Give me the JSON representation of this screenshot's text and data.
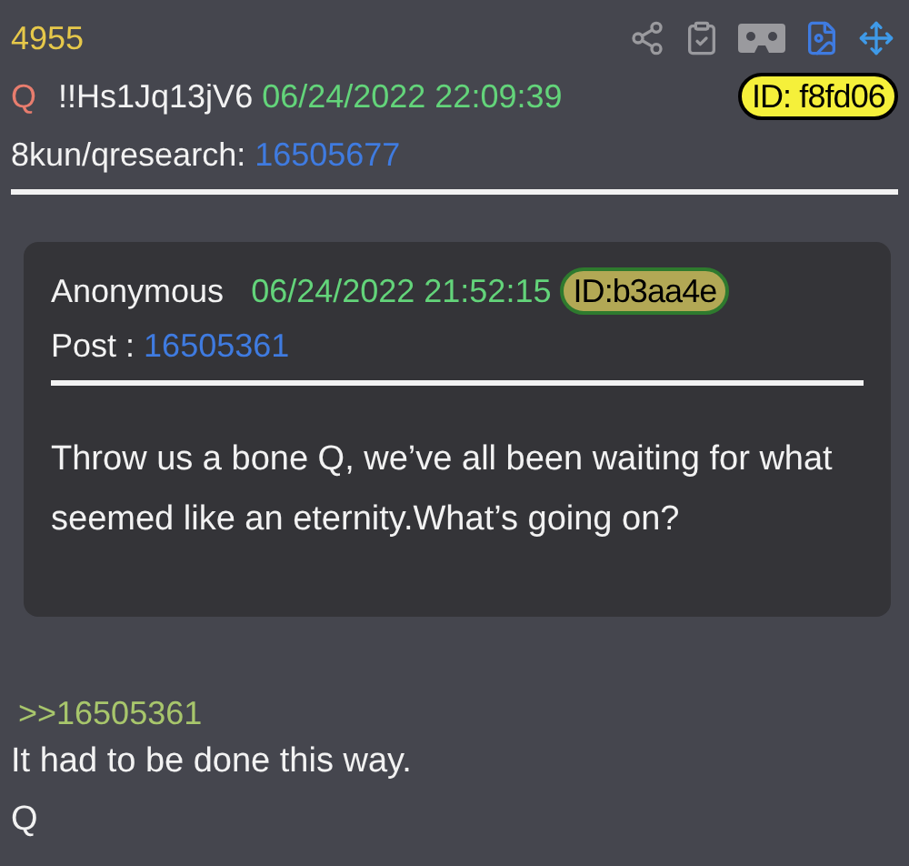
{
  "post_number": "4955",
  "header": {
    "name": "Q",
    "tripcode": "!!Hs1Jq13jV6",
    "date": "06/24/2022 22:09:39",
    "id": "ID: f8fd06"
  },
  "board": {
    "label": "8kun/qresearch:",
    "post_link": "16505677"
  },
  "quoted_post": {
    "name": "Anonymous",
    "date": "06/24/2022 21:52:15",
    "id": "ID:b3aa4e",
    "post_label": "Post :",
    "post_link": "16505361",
    "body": "Throw us a bone Q, we’ve all been waiting for what seemed like an eternity.What’s going on?"
  },
  "reply": {
    "quote_link": ">>16505361",
    "lines": [
      "It had to be done this way.",
      "Q"
    ]
  }
}
